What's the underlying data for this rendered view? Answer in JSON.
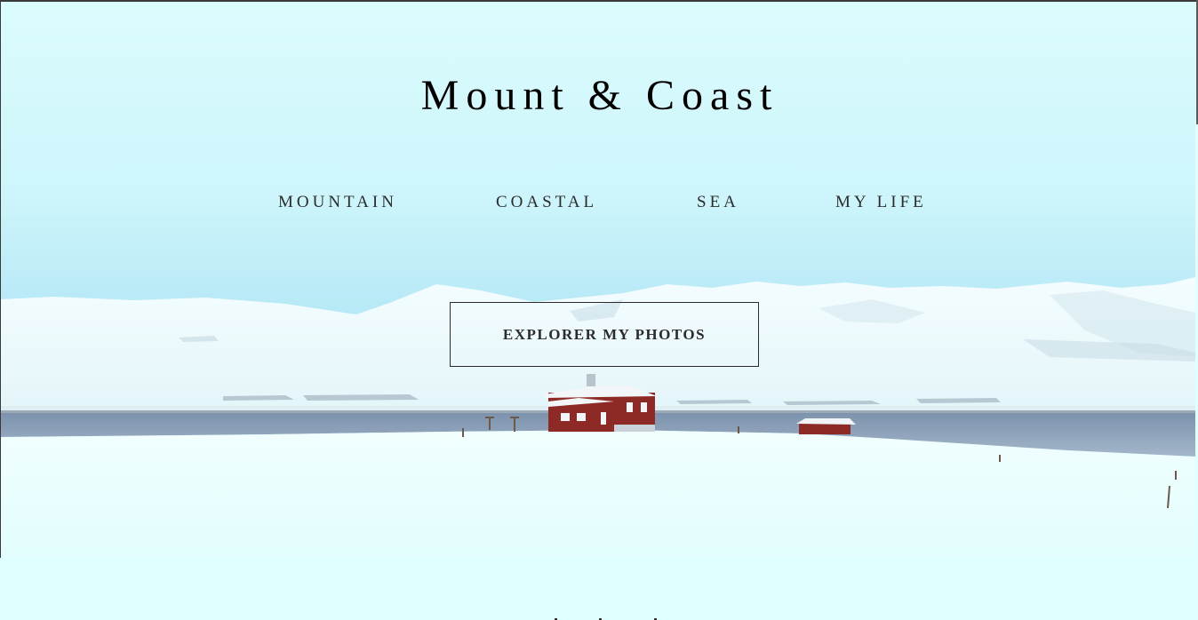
{
  "site": {
    "title": "Mount & Coast"
  },
  "nav": {
    "items": [
      {
        "label": "MOUNTAIN"
      },
      {
        "label": "COASTAL"
      },
      {
        "label": "SEA"
      },
      {
        "label": "MY LIFE"
      }
    ]
  },
  "hero": {
    "cta_label": "EXPLORER MY PHOTOS",
    "image": "snowy-fjord-red-house"
  },
  "colors": {
    "page_background": "#e0ffff",
    "sky_top": "#d8fbfd",
    "sky_bottom": "#9fd9ef",
    "snow": "#eefdfd",
    "water": "#8fa5bd",
    "house_red": "#8e2a26",
    "text": "#000000"
  }
}
